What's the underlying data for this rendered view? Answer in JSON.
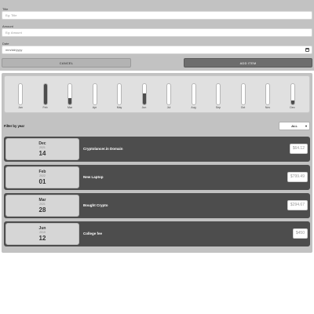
{
  "form": {
    "title_label": "Title",
    "title_placeholder": "Eg: Title",
    "amount_label": "Amount",
    "amount_placeholder": "Eg: Amount",
    "date_label": "Date",
    "date_value": "mm/dd/yyyy",
    "cancel_label": "CANCEL",
    "add_label": "ADD ITEM"
  },
  "chart_data": {
    "type": "bar",
    "categories": [
      "Jan",
      "Feb",
      "Mar",
      "Apr",
      "May",
      "Jun",
      "Jul",
      "Aug",
      "Sep",
      "Oct",
      "Nov",
      "Dec"
    ],
    "values": [
      0,
      1.0,
      0.3,
      0,
      0,
      0.55,
      0,
      0,
      0,
      0,
      0,
      0.2
    ],
    "ylim": [
      0,
      1
    ]
  },
  "filter": {
    "label": "Filter by year",
    "selected": "ALL"
  },
  "expenses": [
    {
      "month": "Dec",
      "year": "2021",
      "day": "14",
      "title": "Cryptolancer.in Domain",
      "amount": "$64.12"
    },
    {
      "month": "Feb",
      "year": "2022",
      "day": "01",
      "title": "New Laptop",
      "amount": "$799.49"
    },
    {
      "month": "Mar",
      "year": "2021",
      "day": "28",
      "title": "Bought Crypto",
      "amount": "$294.67"
    },
    {
      "month": "Jun",
      "year": "2019",
      "day": "12",
      "title": "College fee",
      "amount": "$450"
    }
  ],
  "colors": {
    "panel": "#c2c2c2",
    "bar_fill": "#4d4d4d",
    "item_background": "#4d4d4d"
  }
}
